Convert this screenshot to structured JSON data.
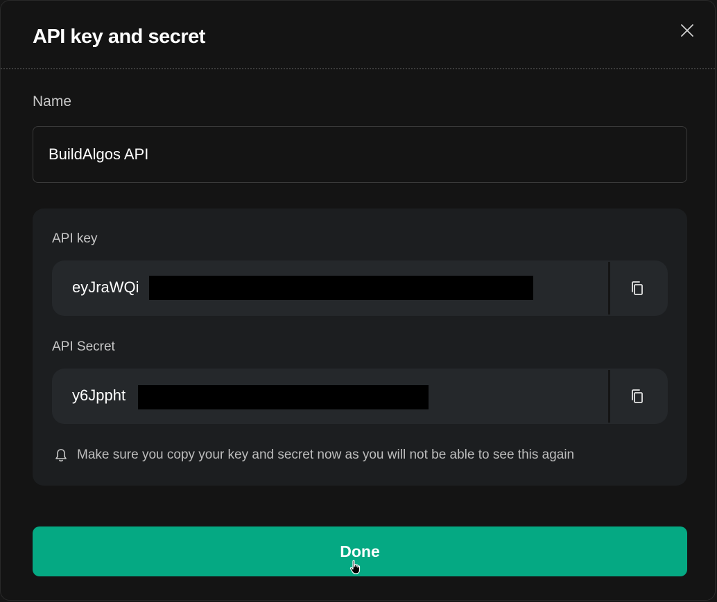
{
  "dialog": {
    "title": "API key and secret",
    "close_icon": "close-icon"
  },
  "name_field": {
    "label": "Name",
    "value": "BuildAlgos API"
  },
  "api_key": {
    "label": "API key",
    "visible_value": "eyJraWQi",
    "copy_icon": "copy-icon"
  },
  "api_secret": {
    "label": "API Secret",
    "visible_value": "y6Jppht",
    "copy_icon": "copy-icon"
  },
  "notice": {
    "icon": "bell-icon",
    "text": "Make sure you copy your key and secret now as you will not be able to see this again"
  },
  "actions": {
    "done_label": "Done"
  },
  "colors": {
    "accent": "#05a983",
    "background": "#141414",
    "panel": "#1c1e20",
    "field": "#25282b"
  }
}
